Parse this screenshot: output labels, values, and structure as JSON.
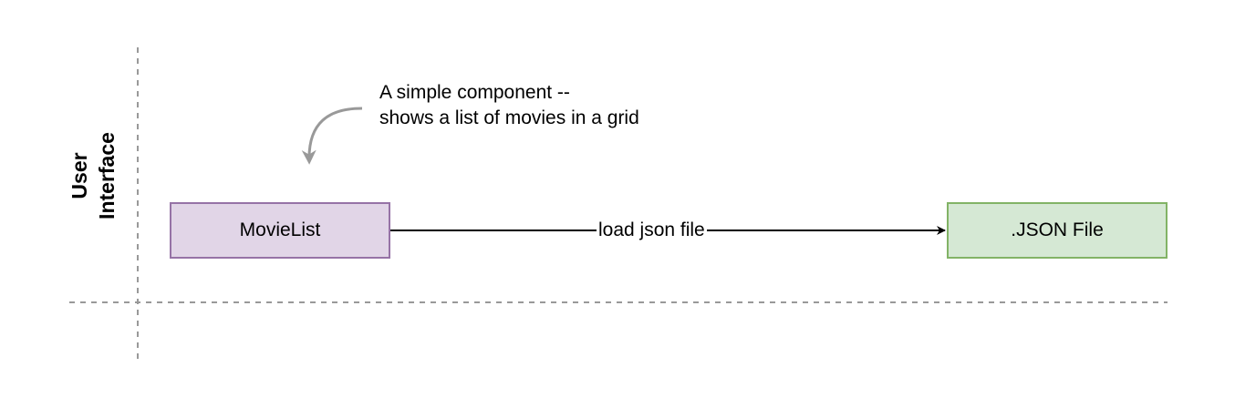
{
  "lane": {
    "label_line1": "User",
    "label_line2": "Interface"
  },
  "nodes": {
    "movielist": {
      "label": "MovieList",
      "fill": "#e1d5e7",
      "stroke": "#9673a6"
    },
    "json_file": {
      "label": ".JSON File",
      "fill": "#d5e8d4",
      "stroke": "#82b366"
    }
  },
  "edge": {
    "label": "load json file"
  },
  "note": {
    "line1": "A simple component --",
    "line2": "shows a list of movies in a grid"
  },
  "colors": {
    "guide_line": "#999999",
    "note_arrow": "#999999",
    "edge": "#000000"
  }
}
